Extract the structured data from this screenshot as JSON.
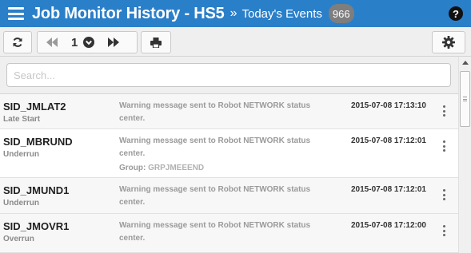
{
  "header": {
    "title": "Job Monitor History - HS5",
    "separator": "»",
    "subtitle": "Today's Events",
    "count": "966",
    "help_label": "?"
  },
  "toolbar": {
    "page_number": "1",
    "icons": [
      "refresh-icon",
      "first-page-icon",
      "page-dropdown-icon",
      "last-page-icon",
      "print-icon",
      "gear-icon"
    ]
  },
  "search": {
    "placeholder": "Search...",
    "value": ""
  },
  "events": [
    {
      "name": "SID_JMLAT2",
      "type": "Late Start",
      "message": "Warning message sent to Robot NETWORK status center.",
      "group_label": "",
      "group": "",
      "timestamp": "2015-07-08 17:13:10"
    },
    {
      "name": "SID_MBRUND",
      "type": "Underrun",
      "message": "Warning message sent to Robot NETWORK status center.",
      "group_label": "Group:",
      "group": "GRPJMEEEND",
      "timestamp": "2015-07-08 17:12:01"
    },
    {
      "name": "SID_JMUND1",
      "type": "Underrun",
      "message": "Warning message sent to Robot NETWORK status center.",
      "group_label": "",
      "group": "",
      "timestamp": "2015-07-08 17:12:01"
    },
    {
      "name": "SID_JMOVR1",
      "type": "Overrun",
      "message": "Warning message sent to Robot NETWORK status center.",
      "group_label": "",
      "group": "",
      "timestamp": "2015-07-08 17:12:00"
    }
  ],
  "colors": {
    "header_bg": "#2a7fc9",
    "badge_bg": "#7e7e7e",
    "toolbar_bg": "#efefef"
  }
}
